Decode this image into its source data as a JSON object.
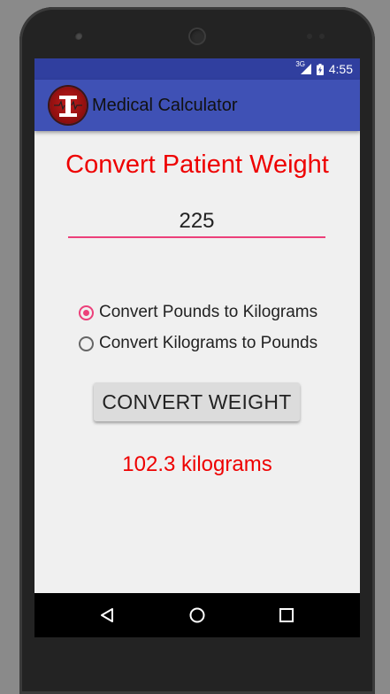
{
  "status_bar": {
    "network": "3G",
    "time": "4:55"
  },
  "app_bar": {
    "title": "Medical Calculator",
    "logo_icon": "medical-logo-icon"
  },
  "main": {
    "heading": "Convert Patient Weight",
    "weight_input": {
      "value": "225"
    },
    "options": [
      {
        "label": "Convert Pounds to Kilograms",
        "selected": true
      },
      {
        "label": "Convert Kilograms to Pounds",
        "selected": false
      }
    ],
    "convert_button": "CONVERT WEIGHT",
    "result": "102.3 kilograms"
  },
  "colors": {
    "primary": "#3f51b5",
    "primary_dark": "#303f9f",
    "accent": "#ec407a",
    "text_red": "#ee0000"
  },
  "nav_bar": {
    "back_icon": "back-icon",
    "home_icon": "home-icon",
    "recents_icon": "recents-icon"
  }
}
